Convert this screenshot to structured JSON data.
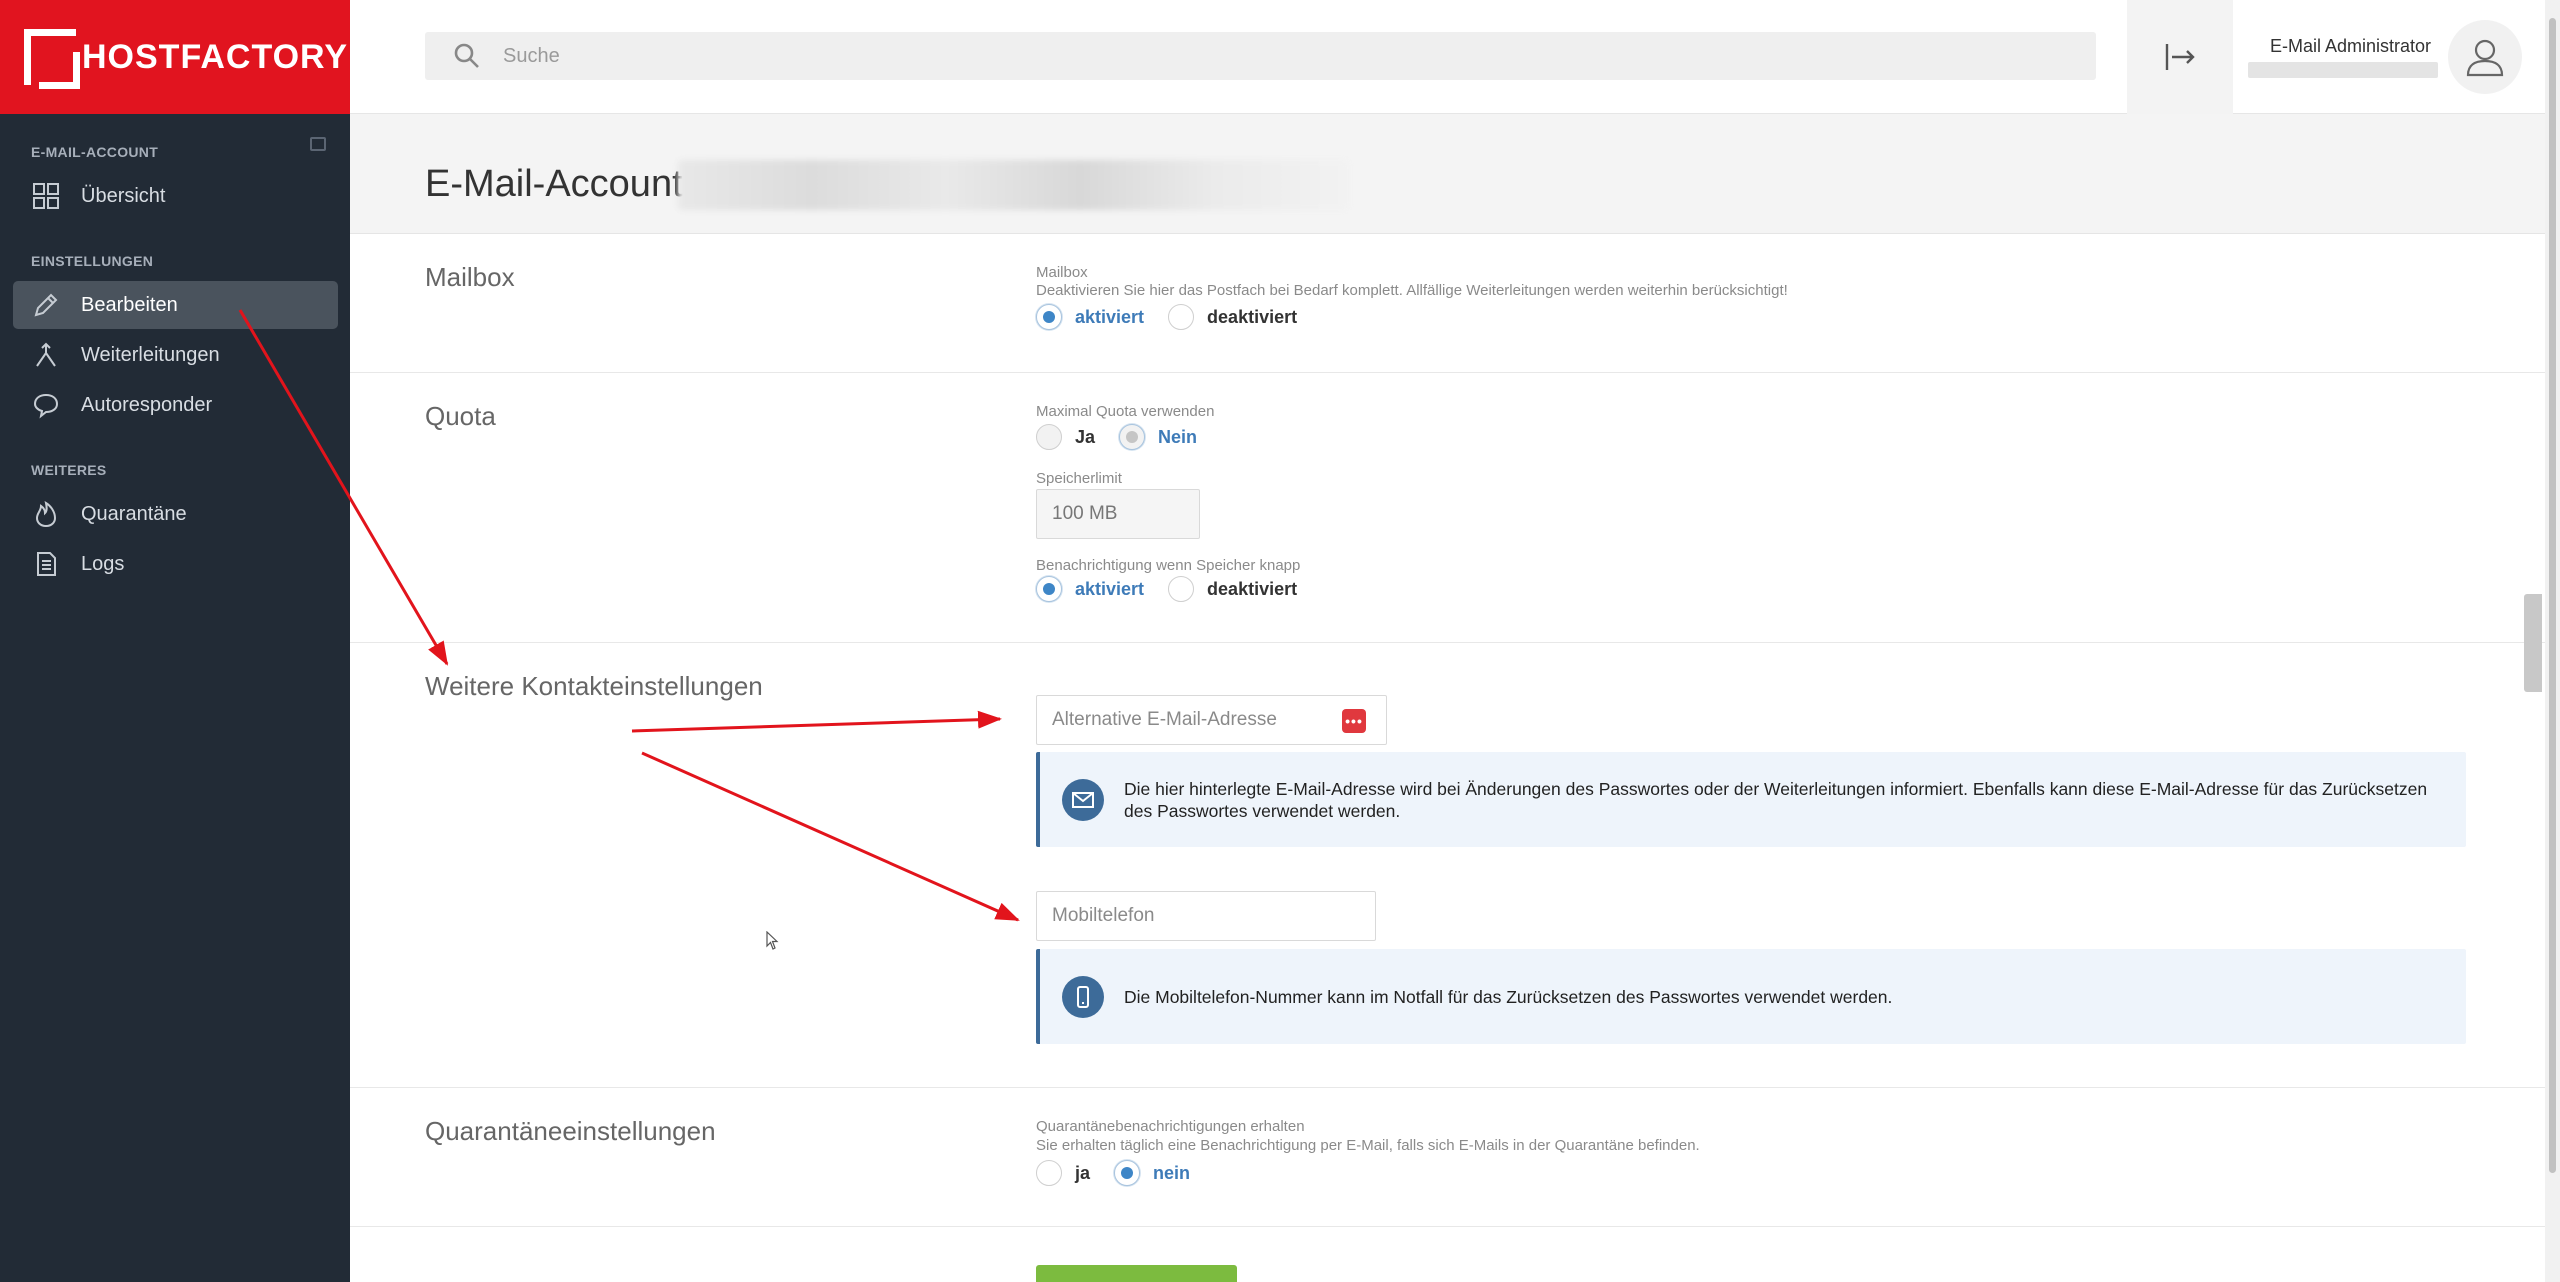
{
  "brand": {
    "name": "HOSTFACTORY",
    "color": "#e1141f"
  },
  "sidebar": {
    "sections": [
      {
        "label": "E-MAIL-ACCOUNT"
      },
      {
        "label": "EINSTELLUNGEN"
      },
      {
        "label": "WEITERES"
      }
    ],
    "items": [
      {
        "label": "Übersicht",
        "icon": "grid-icon"
      },
      {
        "label": "Bearbeiten",
        "icon": "pencil-icon",
        "active": true
      },
      {
        "label": "Weiterleitungen",
        "icon": "fork-icon"
      },
      {
        "label": "Autoresponder",
        "icon": "speech-bubble-icon"
      },
      {
        "label": "Quarantäne",
        "icon": "fire-icon"
      },
      {
        "label": "Logs",
        "icon": "document-icon"
      }
    ]
  },
  "topbar": {
    "search_placeholder": "Suche",
    "user_name": "E-Mail Administrator"
  },
  "page": {
    "title": "E-Mail-Account"
  },
  "mailbox": {
    "section_title": "Mailbox",
    "label": "Mailbox",
    "description": "Deaktivieren Sie hier das Postfach bei Bedarf komplett. Allfällige Weiterleitungen werden weiterhin berücksichtigt!",
    "options": [
      "aktiviert",
      "deaktiviert"
    ],
    "selected": "aktiviert"
  },
  "quota": {
    "section_title": "Quota",
    "max_quota_label": "Maximal Quota verwenden",
    "max_quota_options": [
      "Ja",
      "Nein"
    ],
    "max_quota_selected": "Nein",
    "storage_label": "Speicherlimit",
    "storage_value": "100 MB",
    "notify_label": "Benachrichtigung wenn Speicher knapp",
    "notify_options": [
      "aktiviert",
      "deaktiviert"
    ],
    "notify_selected": "aktiviert"
  },
  "contact": {
    "section_title": "Weitere Kontakteinstellungen",
    "alt_email_placeholder": "Alternative E-Mail-Adresse",
    "alt_email_info": "Die hier hinterlegte E-Mail-Adresse wird bei Änderungen des Passwortes oder der Weiterleitungen informiert. Ebenfalls kann diese E-Mail-Adresse für das Zurücksetzen des Passwortes verwendet werden.",
    "mobile_placeholder": "Mobiltelefon",
    "mobile_info": "Die Mobiltelefon-Nummer kann im Notfall für das Zurücksetzen des Passwortes verwendet werden.",
    "password_manager_badge": "•••"
  },
  "quarantine": {
    "section_title": "Quarantäneeinstellungen",
    "label": "Quarantänebenachrichtigungen erhalten",
    "description": "Sie erhalten täglich eine Benachrichtigung per E-Mail, falls sich E-Mails in der Quarantäne befinden.",
    "options": [
      "ja",
      "nein"
    ],
    "selected": "nein"
  },
  "colors": {
    "accent": "#3e86c7",
    "sidebar_bg": "#222b36",
    "info_border": "#3d6b99",
    "info_bg": "#eef4fb",
    "save_button": "#7cbb3f",
    "annotation": "#e2141c"
  }
}
